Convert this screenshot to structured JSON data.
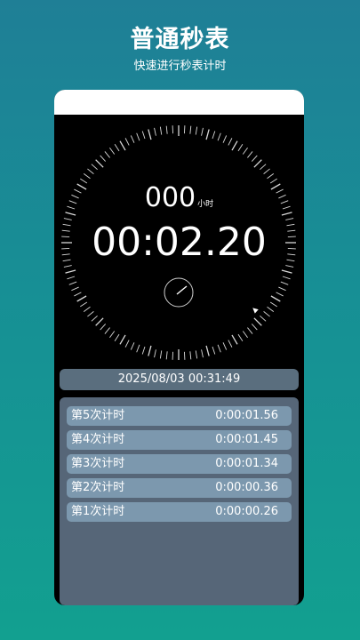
{
  "header": {
    "title": "普通秒表",
    "subtitle": "快速进行秒表计时"
  },
  "stopwatch": {
    "hours_value": "000",
    "hours_unit": "小时",
    "elapsed": "00:02.20"
  },
  "timestamp": "2025/08/03 00:31:49",
  "laps": [
    {
      "label": "第5次计时",
      "time": "0:00:01.56"
    },
    {
      "label": "第4次计时",
      "time": "0:00:01.45"
    },
    {
      "label": "第3次计时",
      "time": "0:00:01.34"
    },
    {
      "label": "第2次计时",
      "time": "0:00:00.36"
    },
    {
      "label": "第1次计时",
      "time": "0:00:00.26"
    }
  ]
}
